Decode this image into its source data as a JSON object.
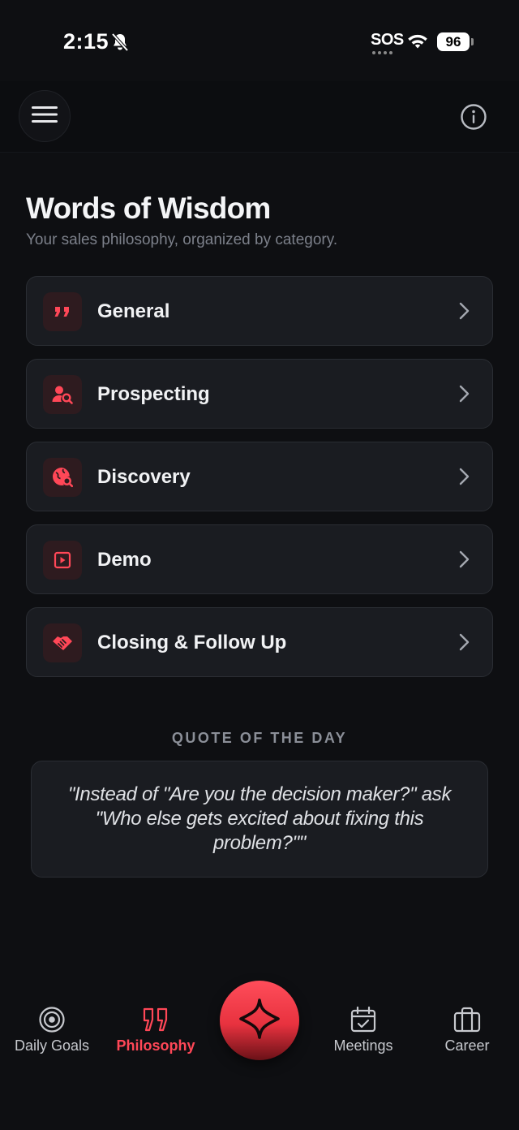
{
  "status_bar": {
    "time": "2:15",
    "sos": "SOS",
    "battery": "96"
  },
  "header": {
    "menu_icon": "hamburger-icon",
    "info_icon": "info-icon"
  },
  "page": {
    "title": "Words of Wisdom",
    "subtitle": "Your sales philosophy, organized by category."
  },
  "categories": [
    {
      "label": "General",
      "icon": "quote-icon"
    },
    {
      "label": "Prospecting",
      "icon": "user-search-icon"
    },
    {
      "label": "Discovery",
      "icon": "globe-search-icon"
    },
    {
      "label": "Demo",
      "icon": "play-square-icon"
    },
    {
      "label": "Closing & Follow Up",
      "icon": "handshake-icon"
    }
  ],
  "quote_of_the_day": {
    "label": "QUOTE OF THE DAY",
    "text": "\"Instead of \"Are you the decision maker?\" ask \"Who else gets excited about fixing this problem?\"\""
  },
  "tabs": [
    {
      "label": "Daily Goals",
      "icon": "target-icon",
      "active": false
    },
    {
      "label": "Philosophy",
      "icon": "quote-icon",
      "active": true
    },
    {
      "label": "Meetings",
      "icon": "calendar-check-icon",
      "active": false
    },
    {
      "label": "Career",
      "icon": "briefcase-icon",
      "active": false
    }
  ],
  "fab": {
    "icon": "sparkle-icon"
  },
  "colors": {
    "accent": "#ff4757",
    "background": "#0e0f12",
    "card": "#1a1c21",
    "icon_bg": "#2e1b1f"
  }
}
